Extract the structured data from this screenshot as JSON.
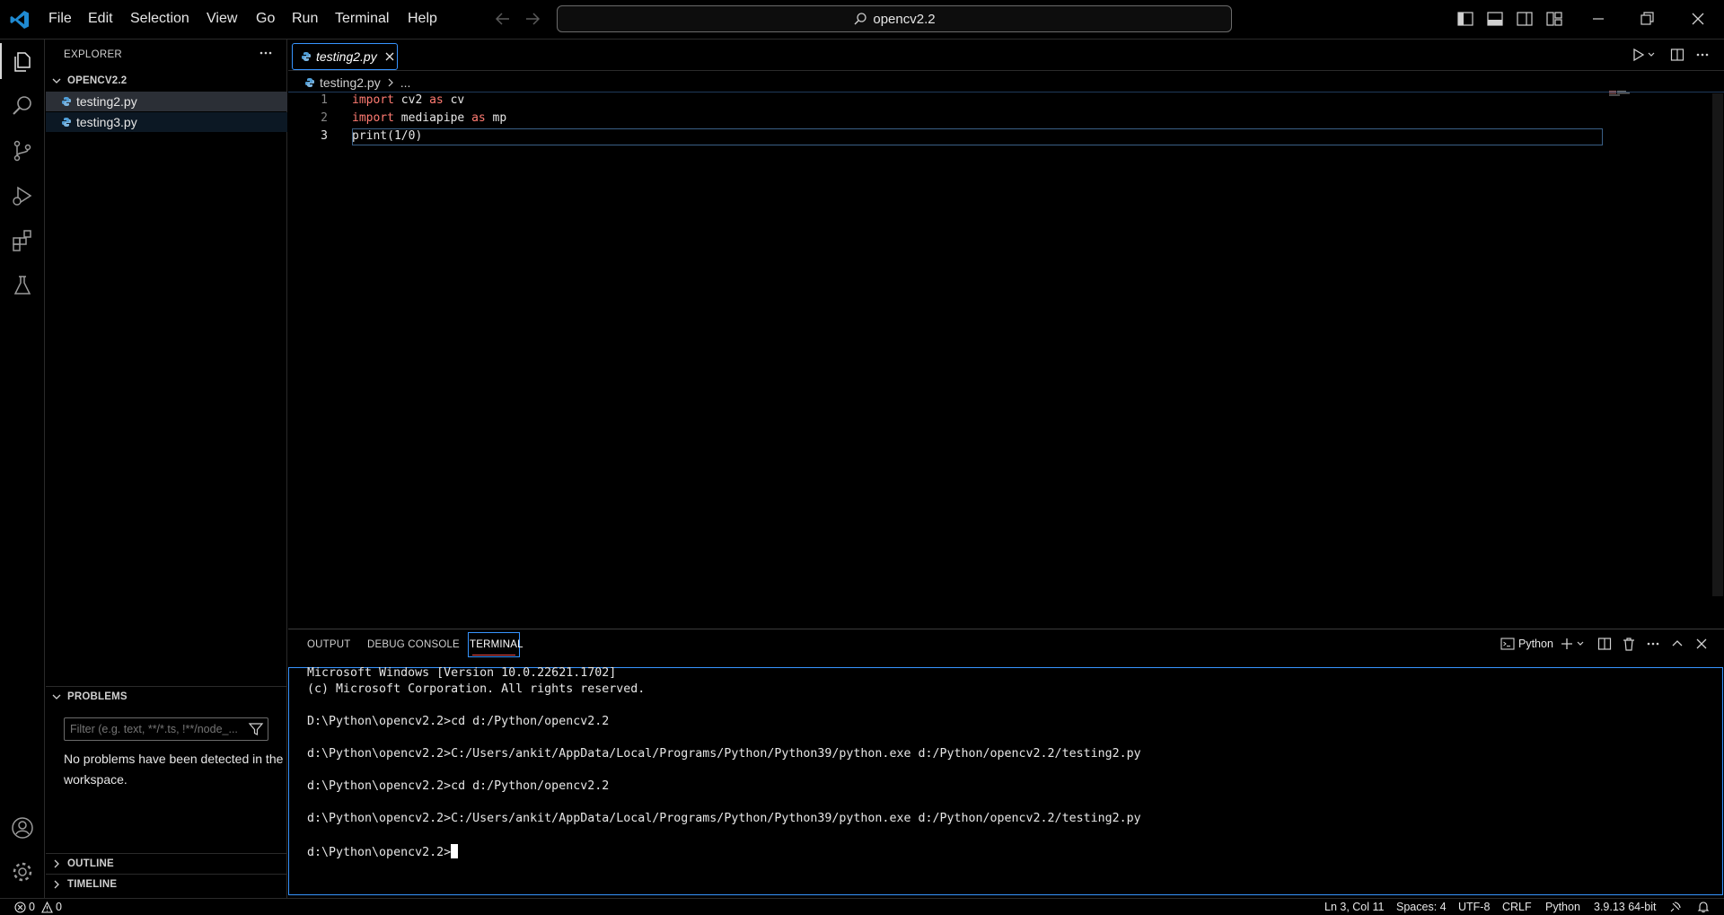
{
  "menu": [
    "File",
    "Edit",
    "Selection",
    "View",
    "Go",
    "Run",
    "Terminal",
    "Help"
  ],
  "search": {
    "value": "opencv2.2"
  },
  "sidebar": {
    "title": "EXPLORER",
    "folder": "OPENCV2.2",
    "files": [
      {
        "name": "testing2.py",
        "selected": true
      },
      {
        "name": "testing3.py",
        "selected": false
      }
    ],
    "problems": {
      "header": "PROBLEMS",
      "filter_placeholder": "Filter (e.g. text, **/*.ts, !**/node_...",
      "message": "No problems have been detected in the workspace."
    },
    "outline": "OUTLINE",
    "timeline": "TIMELINE"
  },
  "editor": {
    "tab_label": "testing2.py",
    "breadcrumb_file": "testing2.py",
    "breadcrumb_more": "...",
    "lines": [
      {
        "num": "1",
        "tokens": [
          [
            "kw",
            "import"
          ],
          [
            "t",
            " cv2 "
          ],
          [
            "kw",
            "as"
          ],
          [
            "t",
            " cv"
          ]
        ]
      },
      {
        "num": "2",
        "tokens": [
          [
            "kw",
            "import"
          ],
          [
            "t",
            " mediapipe "
          ],
          [
            "kw",
            "as"
          ],
          [
            "t",
            " mp"
          ]
        ]
      },
      {
        "num": "3",
        "tokens": [
          [
            "t",
            "print(1/0)"
          ]
        ]
      }
    ]
  },
  "panel": {
    "tabs": [
      "OUTPUT",
      "DEBUG CONSOLE",
      "TERMINAL"
    ],
    "active_tab": "TERMINAL",
    "shell_label": "Python",
    "terminal_lines": [
      "Microsoft Windows [Version 10.0.22621.1702]",
      "(c) Microsoft Corporation. All rights reserved.",
      "",
      "D:\\Python\\opencv2.2>cd d:/Python/opencv2.2",
      "",
      "d:\\Python\\opencv2.2>C:/Users/ankit/AppData/Local/Programs/Python/Python39/python.exe d:/Python/opencv2.2/testing2.py",
      "",
      "d:\\Python\\opencv2.2>cd d:/Python/opencv2.2",
      "",
      "d:\\Python\\opencv2.2>C:/Users/ankit/AppData/Local/Programs/Python/Python39/python.exe d:/Python/opencv2.2/testing2.py",
      "",
      "d:\\Python\\opencv2.2>"
    ]
  },
  "statusbar": {
    "errors": "0",
    "warnings": "0",
    "position": "Ln 3, Col 11",
    "spaces": "Spaces: 4",
    "encoding": "UTF-8",
    "eol": "CRLF",
    "language": "Python",
    "interpreter": "3.9.13 64-bit"
  },
  "colors": {
    "accent": "#3794ff",
    "keyword": "#ff7b72",
    "background": "#000000",
    "terminal_tab_underline": "#f14c4c"
  }
}
